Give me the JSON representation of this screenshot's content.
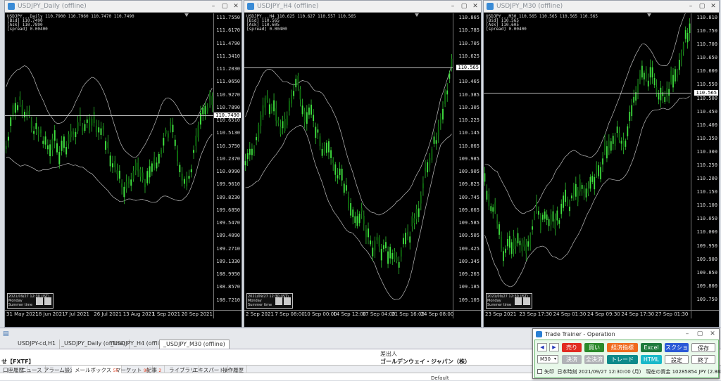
{
  "charts": [
    {
      "title": "USDJPY_Daily (offline)",
      "info": [
        "USDJPY...Daily 110.7900 110.7960 110.7470 110.7490",
        "[Bid] 110.7490",
        "[Ask] 110.7890",
        "[spread] 0.00400"
      ],
      "ticks": [
        "111.7550",
        "111.6170",
        "111.4790",
        "111.3410",
        "111.2030",
        "111.0650",
        "110.9270",
        "110.7890",
        "110.6510",
        "110.5130",
        "110.3750",
        "110.2370",
        "110.0990",
        "109.9610",
        "109.8230",
        "109.6850",
        "109.5470",
        "109.4090",
        "109.2710",
        "109.1330",
        "108.9950",
        "108.8570",
        "108.7210"
      ],
      "price_tag": "110.7490",
      "times": [
        "31 May 2021",
        "18 Jun 2021",
        "7 Jul 2021",
        "26 Jul 2021",
        "13 Aug 2021",
        "1 Sep 2021",
        "20 Sep 2021"
      ],
      "clock": [
        "2021/09/27 12:30 (JST)",
        "Monday",
        "Summer time"
      ]
    },
    {
      "title": "USDJPY_H4 (offline)",
      "info": [
        "USDJPY...H4 110.625 110.627 110.557 110.565",
        "[Bid] 110.565",
        "[Ask] 110.605",
        "[spread] 0.00400"
      ],
      "ticks": [
        "110.865",
        "110.785",
        "110.705",
        "110.625",
        "110.545",
        "110.465",
        "110.385",
        "110.305",
        "110.225",
        "110.145",
        "110.065",
        "109.985",
        "109.905",
        "109.825",
        "109.745",
        "109.665",
        "109.585",
        "109.505",
        "109.425",
        "109.345",
        "109.265",
        "109.185",
        "109.105"
      ],
      "price_tag": "110.565",
      "times": [
        "2 Sep 2021",
        "7 Sep 08:00",
        "10 Sep 00:00",
        "14 Sep 12:00",
        "17 Sep 04:00",
        "21 Sep 16:00",
        "24 Sep 08:00"
      ],
      "clock": [
        "2021/09/27 12:30 (JST)",
        "Monday",
        "Summer time"
      ]
    },
    {
      "title": "USDJPY_M30 (offline)",
      "info": [
        "USDJPY...M30 110.565 110.565 110.565 110.565",
        "[Bid] 110.565",
        "[Ask] 110.605",
        "[spread] 0.00400"
      ],
      "ticks": [
        "110.810",
        "110.750",
        "110.700",
        "110.650",
        "110.600",
        "110.550",
        "110.500",
        "110.450",
        "110.400",
        "110.350",
        "110.300",
        "110.250",
        "110.200",
        "110.150",
        "110.100",
        "110.050",
        "110.000",
        "109.950",
        "109.900",
        "109.850",
        "109.800",
        "109.750"
      ],
      "price_tag": "110.565",
      "times": [
        "23 Sep 2021",
        "23 Sep 17:30",
        "24 Sep 01:30",
        "24 Sep 09:30",
        "24 Sep 17:30",
        "27 Sep 01:30"
      ],
      "clock": [
        "2021/09/27 12:30 (JST)",
        "Monday",
        "Summer time"
      ]
    }
  ],
  "chart_tabs": [
    "USDJPY-cd,H1",
    "_USDJPY_Daily (offline)",
    "_USDJPY_H4 (offline)",
    "_USDJPY_M30 (offline)"
  ],
  "terminal": {
    "header_sender": "差出人",
    "row_title": "せ【FXTF】",
    "row_sender": "ゴールデンウェイ・ジャパン（株）",
    "bottom_col": "Default",
    "tabs": [
      {
        "label": "口座履歴",
        "badge": ""
      },
      {
        "label": "ニュース",
        "badge": ""
      },
      {
        "label": "アラーム設定",
        "badge": ""
      },
      {
        "label": "メールボックス",
        "badge": "50"
      },
      {
        "label": "マーケット",
        "badge": "90"
      },
      {
        "label": "記事",
        "badge": "2"
      },
      {
        "label": "ライブラリ",
        "badge": ""
      },
      {
        "label": "エキスパート",
        "badge": ""
      },
      {
        "label": "操作履歴",
        "badge": ""
      }
    ]
  },
  "trade_trainer": {
    "title": "Trade Trainer - Operation",
    "prev": "◀",
    "next": "▶",
    "sell": "売り",
    "buy": "買い",
    "close_pos": "経済指標",
    "excel": "Excel",
    "screenshot": "スクショ",
    "save": "保存",
    "timeframe": "M30",
    "settle": "決済",
    "settle_all": "全決済",
    "trade": "トレード",
    "html": "HTML",
    "settings": "設定",
    "exit": "終了",
    "arrow_label": "矢印",
    "status_text": "日本時刻 2021/09/27 12:30:00 (月)　現在の資金 10285854 JPY (2.86%)"
  }
}
